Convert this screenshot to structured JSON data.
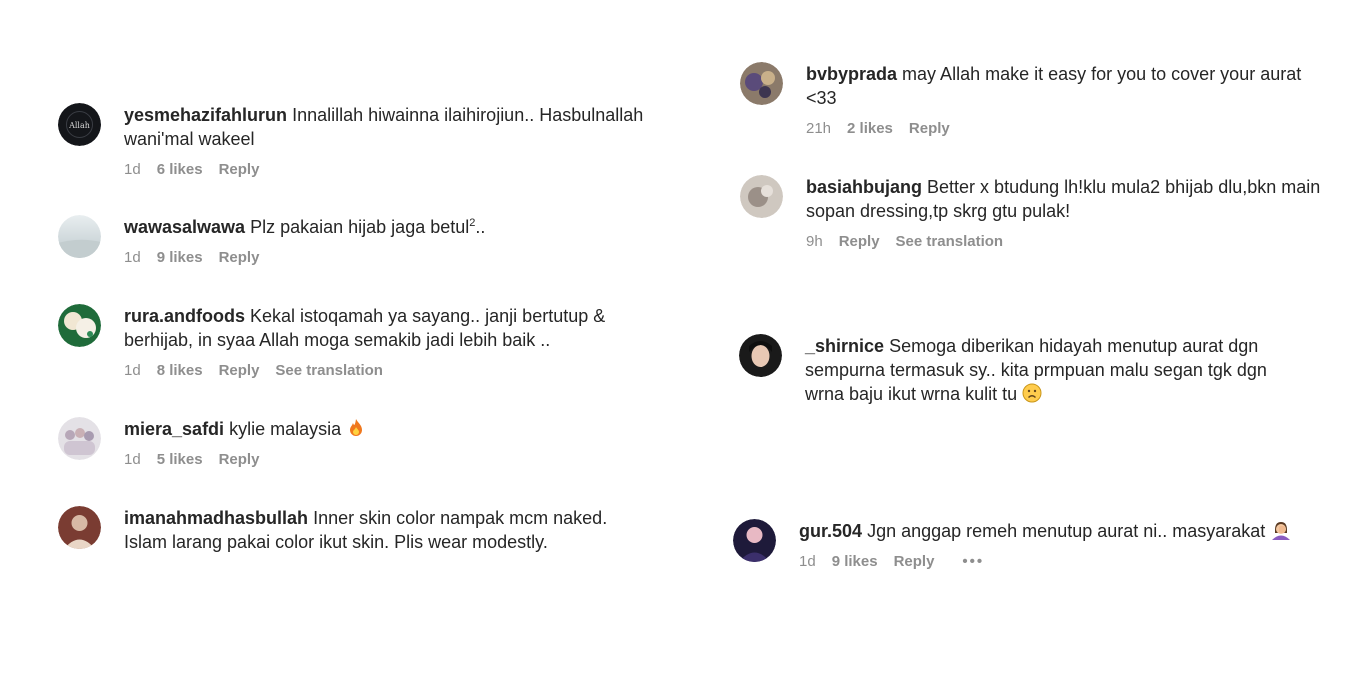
{
  "left_comments": [
    {
      "username": "yesmehazifahlurun",
      "text": "Innalillah hiwainna ilaihirojiun.. Hasbulnallah wani'mal wakeel",
      "time": "1d",
      "likes": "6 likes",
      "reply": "Reply"
    },
    {
      "username": "wawasalwawa",
      "text": "Plz pakaian hijab jaga betul",
      "text_sup": "2",
      "text_after": "..",
      "time": "1d",
      "likes": "9 likes",
      "reply": "Reply"
    },
    {
      "username": "rura.andfoods",
      "text": "Kekal istoqamah ya sayang.. janji bertutup & berhijab, in syaa Allah moga semakib jadi lebih baik ..",
      "time": "1d",
      "likes": "8 likes",
      "reply": "Reply",
      "translation": "See translation"
    },
    {
      "username": "miera_safdi",
      "text": "kylie malaysia",
      "time": "1d",
      "likes": "5 likes",
      "reply": "Reply"
    },
    {
      "username": "imanahmadhasbullah",
      "text": "Inner skin color nampak mcm naked. Islam larang pakai color ikut skin. Plis wear modestly."
    }
  ],
  "right_comments": [
    {
      "username": "bvbyprada",
      "text": "may Allah make it easy for you to cover your aurat <33",
      "time": "21h",
      "likes": "2 likes",
      "reply": "Reply"
    },
    {
      "username": "basiahbujang",
      "text": "Better x btudung lh!klu mula2 bhijab dlu,bkn main sopan dressing,tp skrg gtu pulak!",
      "time": "9h",
      "reply": "Reply",
      "translation": "See translation"
    },
    {
      "username": "_shirnice",
      "text": "Semoga diberikan hidayah menutup aurat dgn sempurna termasuk sy.. kita prmpuan malu segan tgk dgn wrna baju ikut wrna kulit tu"
    },
    {
      "username": "gur.504",
      "text": "Jgn anggap remeh menutup aurat ni.. masyarakat",
      "time": "1d",
      "likes": "9 likes",
      "reply": "Reply",
      "more": "•••"
    }
  ],
  "icons": {
    "fire": "fire-emoji-icon",
    "sad": "sad-face-emoji-icon",
    "facepalm": "facepalm-emoji-icon",
    "more": "more-options-icon"
  },
  "colors": {
    "text": "#262626",
    "meta": "#8e8e8e",
    "background": "#ffffff"
  }
}
